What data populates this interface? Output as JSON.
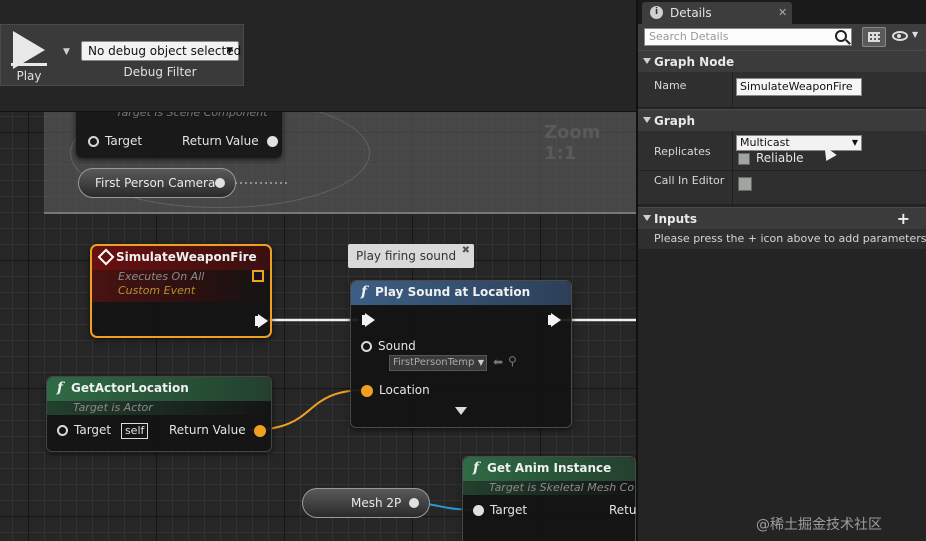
{
  "toolbar": {
    "play_label": "Play",
    "debug_object": "No debug object selected",
    "debug_filter_label": "Debug Filter"
  },
  "graph": {
    "zoom_label": "Zoom 1:1",
    "top_node": {
      "subtitle": "Target is Scene Component",
      "target_label": "Target",
      "return_label": "Return Value"
    },
    "camera_variable": "First Person Camera",
    "mesh_variable": "Mesh 2P",
    "event_node": {
      "title": "SimulateWeaponFire",
      "subtitle1": "Executes On All",
      "subtitle2": "Custom Event"
    },
    "comment_bubble": "Play firing sound",
    "play_sound_node": {
      "title": "Play Sound at Location",
      "sound_label": "Sound",
      "sound_value": "FirstPersonTemp",
      "location_label": "Location"
    },
    "get_actor_location_node": {
      "title": "GetActorLocation",
      "subtitle": "Target is Actor",
      "target_label": "Target",
      "self_label": "self",
      "return_label": "Return Value"
    },
    "get_anim_instance_node": {
      "title": "Get Anim Instance",
      "subtitle": "Target is Skeletal Mesh Co",
      "target_label": "Target",
      "return_label": "Retu"
    }
  },
  "details": {
    "tab_label": "Details",
    "search_placeholder": "Search Details",
    "sections": {
      "graph_node": {
        "title": "Graph Node",
        "name_label": "Name",
        "name_value": "SimulateWeaponFire"
      },
      "graph": {
        "title": "Graph",
        "replicates_label": "Replicates",
        "replicates_value": "Multicast",
        "reliable_label": "Reliable",
        "call_in_editor_label": "Call In Editor"
      },
      "inputs": {
        "title": "Inputs",
        "hint": "Please press the + icon above to add parameters"
      }
    }
  },
  "watermark": "@稀土掘金技术社区",
  "colors": {
    "event_border": "#f0a020",
    "event_header": "#6a1010",
    "function_header_blue": "#3c5f85",
    "pure_header_green": "#2f6b45",
    "vector_pin": "#f0a020"
  }
}
